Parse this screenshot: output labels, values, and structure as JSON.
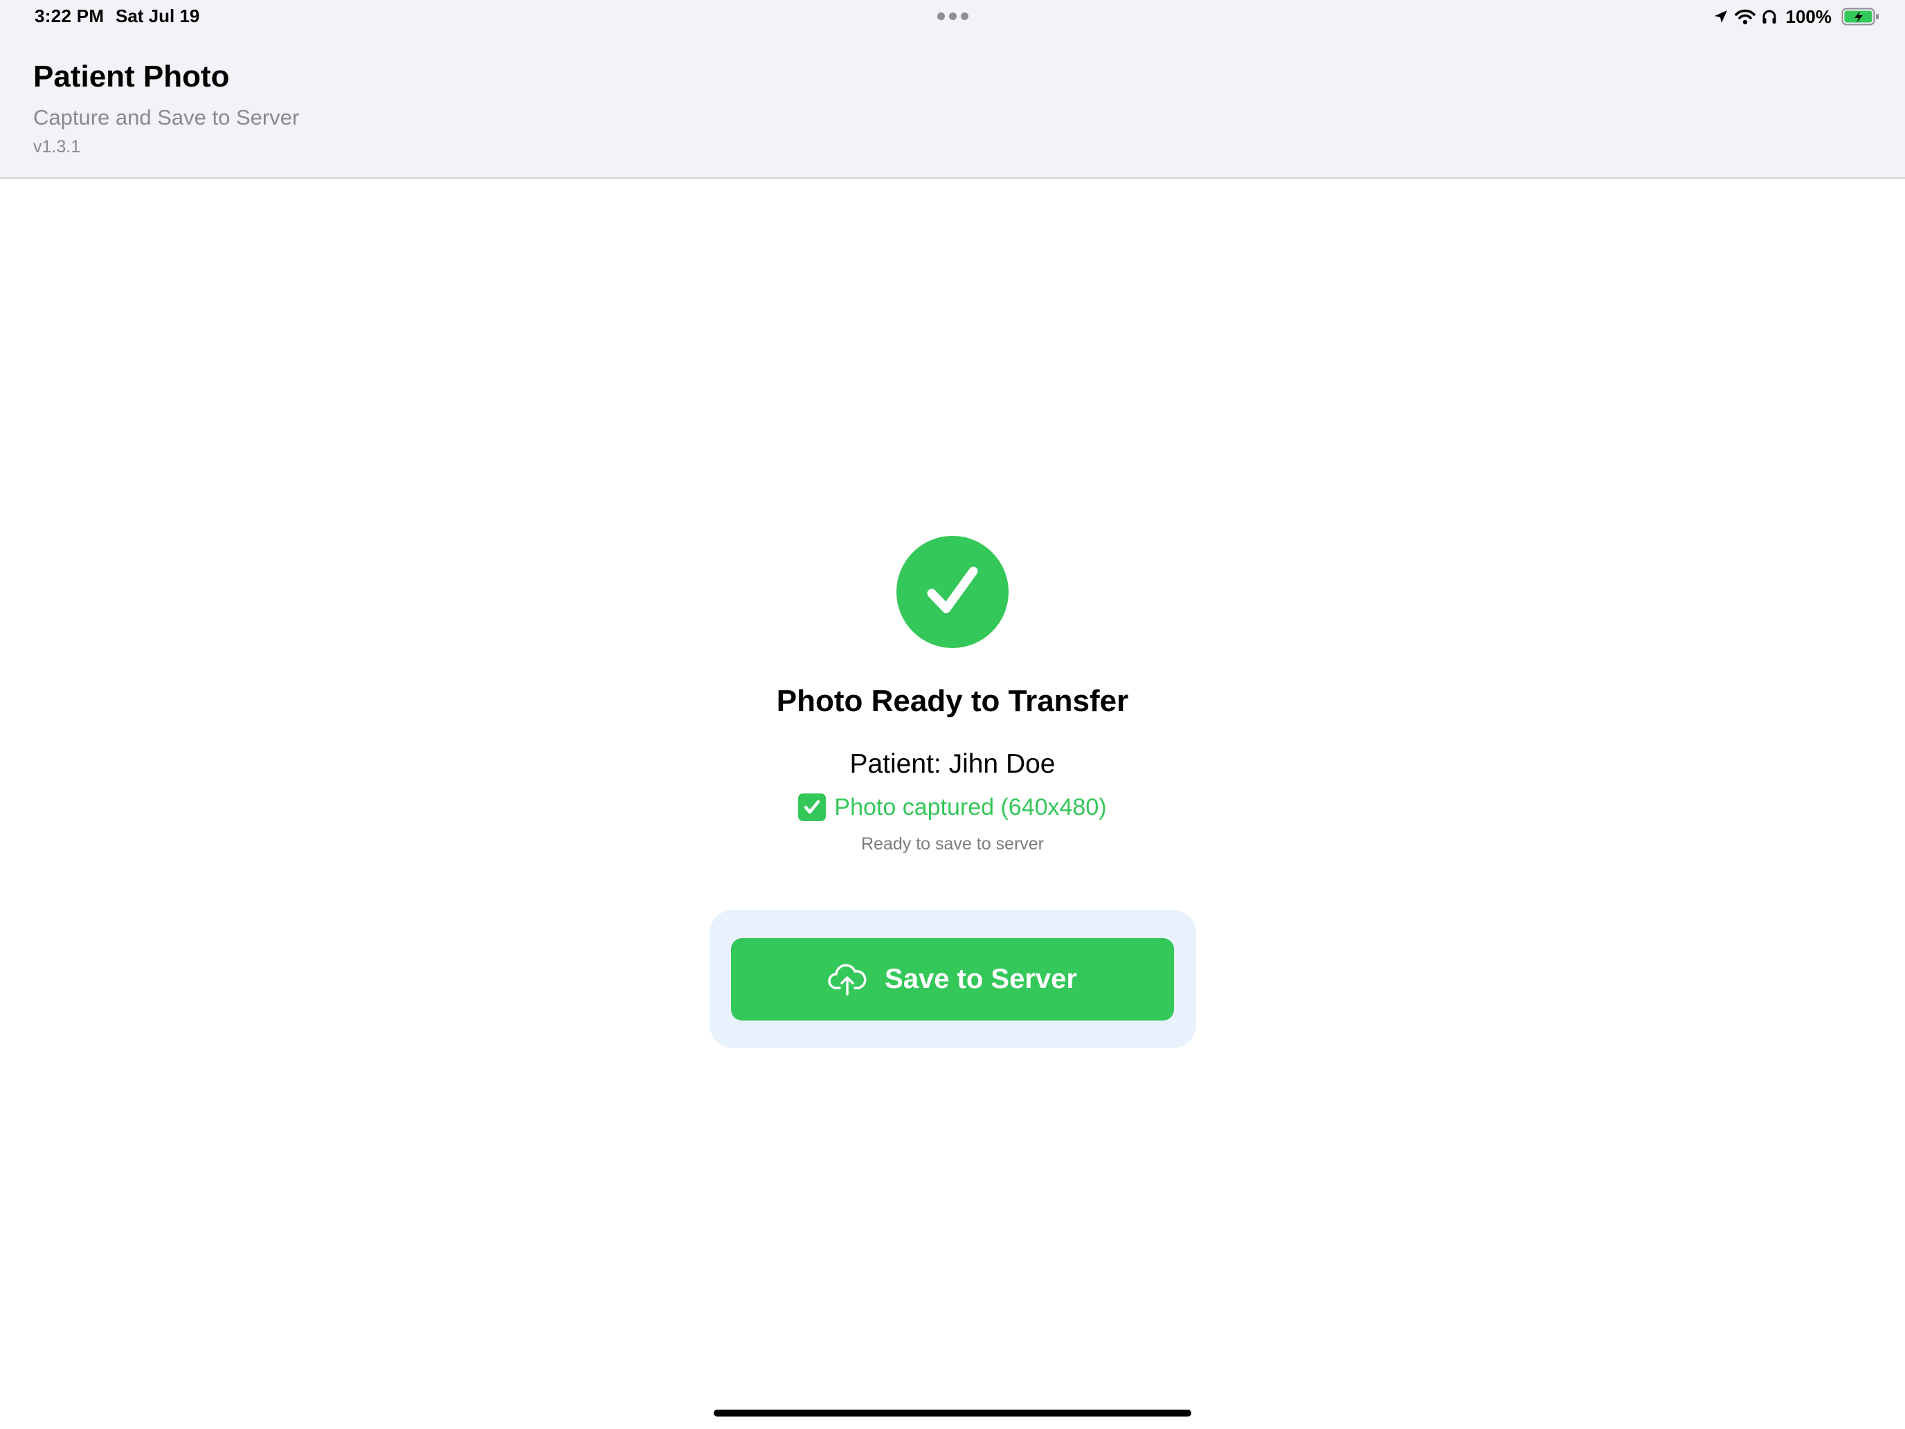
{
  "status_bar": {
    "time": "3:22 PM",
    "date": "Sat Jul 19",
    "battery": "100%",
    "icons": [
      "location-icon",
      "wifi-icon",
      "headphones-icon",
      "battery-charging-icon"
    ]
  },
  "header": {
    "title": "Patient Photo",
    "subtitle": "Capture and Save to Server",
    "version": "v1.3.1"
  },
  "main": {
    "status_icon": "checkmark-circle-icon",
    "headline": "Photo Ready to Transfer",
    "patient": "Patient: Jihn Doe",
    "captured_icon": "check-box-icon",
    "captured": "Photo captured (640x480)",
    "ready": "Ready to save to server",
    "save_button": {
      "label": "Save to Server",
      "icon": "cloud-upload-icon"
    }
  },
  "colors": {
    "accent_green": "#34c759",
    "header_bg": "#f2f2f7",
    "button_well": "#e9f2fc",
    "secondary_text": "#8a8a8e"
  }
}
